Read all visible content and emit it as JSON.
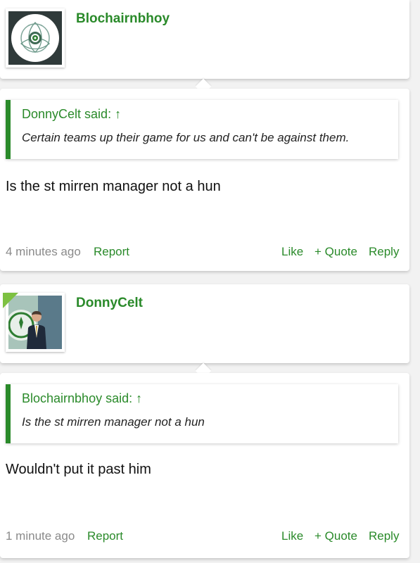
{
  "posts": [
    {
      "author": "Blochairnbhoy",
      "quote": {
        "title": "DonnyCelt said: ↑",
        "text": "Certain teams up their game for us and can't be against them."
      },
      "body": "Is the st mirren manager not a hun",
      "time": "4 minutes ago",
      "actions": {
        "report": "Report",
        "like": "Like",
        "quote": "+ Quote",
        "reply": "Reply"
      }
    },
    {
      "author": "DonnyCelt",
      "quote": {
        "title": "Blochairnbhoy said: ↑",
        "text": "Is the st mirren manager not a hun"
      },
      "body": "Wouldn't put it past him",
      "time": "1 minute ago",
      "actions": {
        "report": "Report",
        "like": "Like",
        "quote": "+ Quote",
        "reply": "Reply"
      }
    }
  ],
  "colors": {
    "accent": "#2a8a2a",
    "muted": "#8a8a8a",
    "background": "#f2f2f2"
  }
}
